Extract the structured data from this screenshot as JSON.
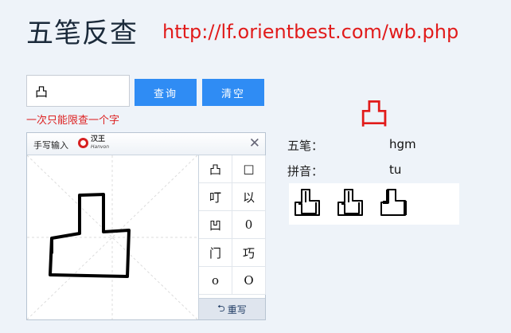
{
  "header": {
    "title": "五笔反查",
    "url": "http://lf.orientbest.com/wb.php"
  },
  "search": {
    "value": "凸",
    "query_label": "查询",
    "clear_label": "清空",
    "hint": "一次只能限查一个字"
  },
  "handwriting": {
    "title": "手写输入",
    "logo_text": "汉王",
    "logo_subtext": "Hanvon",
    "close_icon": "close-icon",
    "candidates": [
      "凸",
      "□",
      "叮",
      "以",
      "凹",
      "0",
      "门",
      "巧",
      "o",
      "O"
    ],
    "rewrite_label": "重写",
    "rewrite_icon": "undo-icon"
  },
  "result": {
    "char": "凸",
    "wubi_label": "五笔：",
    "wubi_value": "hgm",
    "pinyin_label": "拼音：",
    "pinyin_value": "tu"
  },
  "colors": {
    "url": "#e11b1b",
    "button": "#2f8cf4",
    "hint": "#dd2222",
    "result_char": "#e11b1b"
  }
}
